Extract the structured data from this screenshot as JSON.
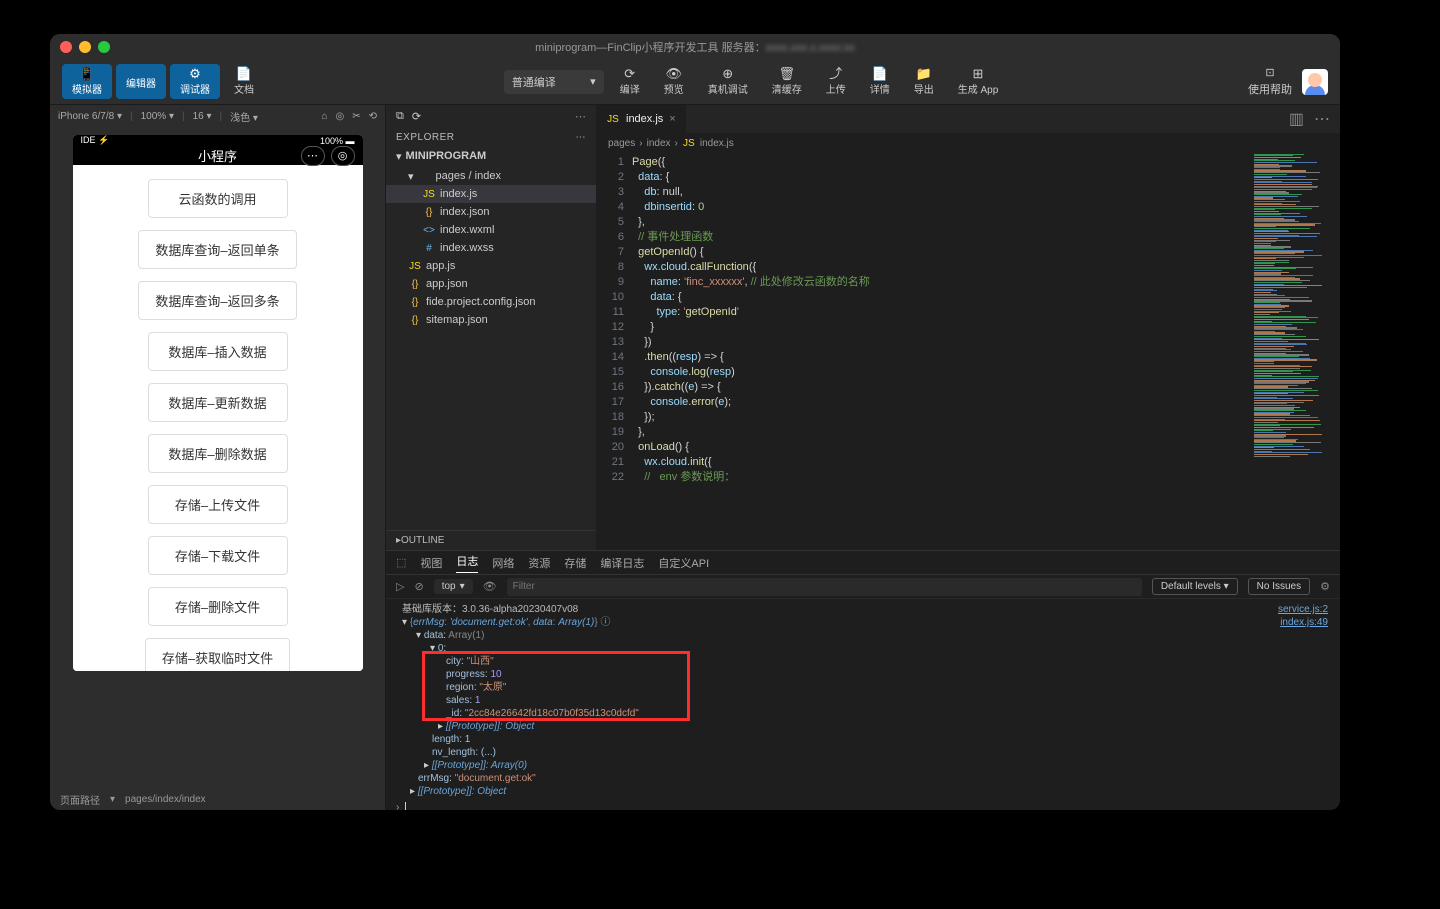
{
  "title": {
    "prefix": "miniprogram—FinClip小程序开发工具 服务器：",
    "blurred": "xxxx.xxx.x.xxxx:xx"
  },
  "tabsTop": [
    {
      "icon": "📱",
      "label": "模拟器",
      "active": true
    },
    {
      "icon": "</>",
      "label": "编辑器",
      "active": true
    },
    {
      "icon": "⚙",
      "label": "调试器",
      "active": true
    },
    {
      "icon": "📄",
      "label": "文档",
      "active": false
    }
  ],
  "compile": "普通编译",
  "centerBtns": [
    {
      "icon": "⟳",
      "label": "编译"
    },
    {
      "icon": "👁",
      "label": "预览"
    },
    {
      "icon": "⊕",
      "label": "真机调试"
    },
    {
      "icon": "🗑",
      "label": "清缓存"
    },
    {
      "icon": "⤴",
      "label": "上传"
    },
    {
      "icon": "📄",
      "label": "详情"
    },
    {
      "icon": "📁",
      "label": "导出"
    },
    {
      "icon": "⊞",
      "label": "生成 App"
    }
  ],
  "help": {
    "icon": "⊡",
    "label": "使用帮助"
  },
  "simTop": {
    "device": "iPhone 6/7/8",
    "zoom": "100%",
    "font": "16",
    "theme": "浅色"
  },
  "phone": {
    "status": {
      "left": "IDE ⚡",
      "right": "100% ▬"
    },
    "title": "小程序",
    "buttons": [
      "云函数的调用",
      "数据库查询–返回单条",
      "数据库查询–返回多条",
      "数据库–插入数据",
      "数据库–更新数据",
      "数据库–删除数据",
      "存储–上传文件",
      "存储–下载文件",
      "存储–删除文件",
      "存储–获取临时文件"
    ]
  },
  "pagePath": {
    "k": "页面路径",
    "v": "pages/index/index"
  },
  "explorer": {
    "title": "EXPLORER",
    "root": "MINIPROGRAM",
    "items": [
      {
        "lvl": 1,
        "chev": "▾",
        "ico": "",
        "name": "pages / index"
      },
      {
        "lvl": 2,
        "ico": "JS",
        "cls": "js",
        "name": "index.js",
        "sel": true
      },
      {
        "lvl": 2,
        "ico": "{}",
        "cls": "json",
        "name": "index.json"
      },
      {
        "lvl": 2,
        "ico": "<>",
        "cls": "xml",
        "name": "index.wxml"
      },
      {
        "lvl": 2,
        "ico": "#",
        "cls": "css",
        "name": "index.wxss"
      },
      {
        "lvl": 1,
        "ico": "JS",
        "cls": "js",
        "name": "app.js"
      },
      {
        "lvl": 1,
        "ico": "{}",
        "cls": "json",
        "name": "app.json"
      },
      {
        "lvl": 1,
        "ico": "{}",
        "cls": "json",
        "name": "fide.project.config.json"
      },
      {
        "lvl": 1,
        "ico": "{}",
        "cls": "json",
        "name": "sitemap.json"
      }
    ],
    "outline": "OUTLINE"
  },
  "editor": {
    "tab": "index.js",
    "crumbs": [
      "pages",
      "index",
      "index.js"
    ],
    "lines": [
      "Page({",
      "  data: {",
      "    db: null,",
      "    dbinsertid: 0",
      "  },",
      "  // 事件处理函数",
      "  getOpenId() {",
      "    wx.cloud.callFunction({",
      "      name: 'finc_xxxxxx', // 此处修改云函数的名称",
      "      data: {",
      "        type: 'getOpenId'",
      "      }",
      "    })",
      "    .then((resp) => {",
      "      console.log(resp)",
      "    }).catch((e) => {",
      "      console.error(e);",
      "    });",
      "  },",
      "  onLoad() {",
      "    wx.cloud.init({",
      "    //   env 参数说明："
    ]
  },
  "console": {
    "tabs": [
      "视图",
      "日志",
      "网络",
      "资源",
      "存储",
      "编译日志",
      "自定义API"
    ],
    "activeTab": 1,
    "top": "top",
    "filter": "Filter",
    "levels": "Default levels",
    "issues": "No Issues",
    "version": "基础库版本：3.0.36-alpha20230407v08",
    "links": [
      "service.js:2",
      "index.js:49"
    ],
    "obj": {
      "errMsgKey": "errMsg",
      "errMsg": "'document.get:ok'",
      "dataKey": "data",
      "dataHead": "Array(1)",
      "dataArr": "Array(1)",
      "idx": "0",
      "fields": [
        {
          "k": "city",
          "v": "\"山西\"",
          "t": "s"
        },
        {
          "k": "progress",
          "v": "10",
          "t": "n"
        },
        {
          "k": "region",
          "v": "\"太原\"",
          "t": "s"
        },
        {
          "k": "sales",
          "v": "1",
          "t": "n"
        },
        {
          "k": "_id",
          "v": "\"2cc84e26642fd18c07b0f35d13c0dcfd\"",
          "t": "s"
        }
      ],
      "proto1": "[[Prototype]]: Object",
      "length": "length: 1",
      "nvlen": "nv_length: (...)",
      "proto2": "[[Prototype]]: Array(0)",
      "errMsg2": "errMsg: \"document.get:ok\"",
      "proto3": "[[Prototype]]: Object"
    }
  }
}
